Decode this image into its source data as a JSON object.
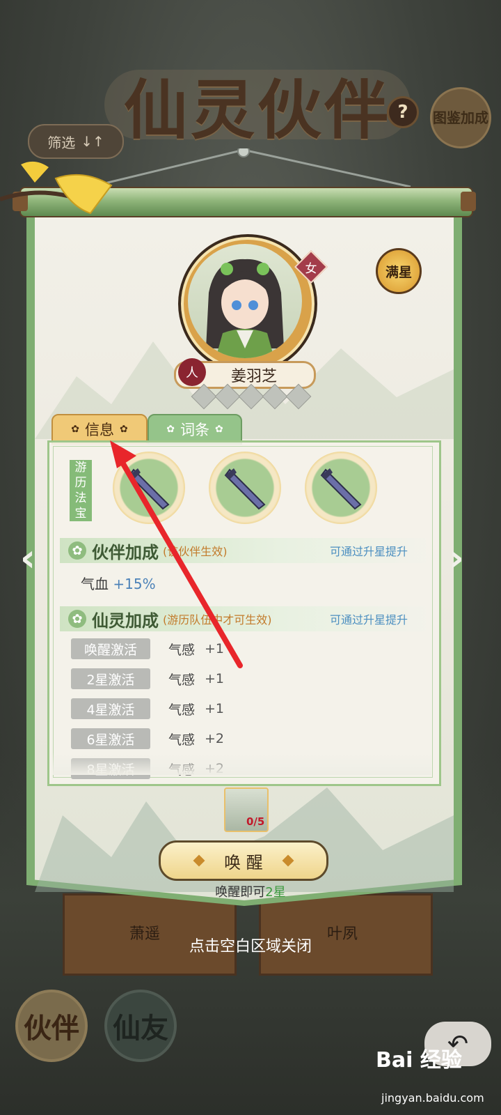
{
  "header": {
    "title": "仙灵伙伴",
    "help_label": "?",
    "codex_label": "图鉴加成",
    "filter_label": "筛选",
    "filter_icon": "↓↑"
  },
  "character": {
    "name": "姜羽芝",
    "gender": "女",
    "race": "人",
    "full_star_label": "满星",
    "star_slots": 5
  },
  "tabs": [
    {
      "label": "信息",
      "active": true
    },
    {
      "label": "词条",
      "active": false
    }
  ],
  "treasure": {
    "label": "游历法宝",
    "slots": 3
  },
  "partner_bonus": {
    "title": "伙伴加成",
    "note": "(该伙伴生效)",
    "hint": "可通过升星提升",
    "stat_name": "气血",
    "stat_value": "+15%"
  },
  "spirit_bonus": {
    "title": "仙灵加成",
    "note": "(游历队伍中才可生效)",
    "hint": "可通过升星提升",
    "rows": [
      {
        "label": "唤醒激活",
        "stat": "气感",
        "value": "+1"
      },
      {
        "label": "2星激活",
        "stat": "气感",
        "value": "+1"
      },
      {
        "label": "4星激活",
        "stat": "气感",
        "value": "+1"
      },
      {
        "label": "6星激活",
        "stat": "气感",
        "value": "+2"
      },
      {
        "label": "8星激活",
        "stat": "气感",
        "value": "+2"
      }
    ]
  },
  "fragment": {
    "count": "0/5"
  },
  "awaken": {
    "button_label": "唤 醒",
    "hint_prefix": "唤醒即可",
    "hint_star": "2星"
  },
  "background_cards": [
    {
      "name": "萧遥"
    },
    {
      "name": "叶夙"
    }
  ],
  "close_hint": "点击空白区域关闭",
  "bottom_nav": {
    "partner": "伙伴",
    "immortal": "仙友",
    "back_icon": "back-arrow-icon"
  },
  "watermark": {
    "brand": "Bai 经验",
    "url": "jingyan.baidu.com"
  },
  "colors": {
    "scroll_green": "#7fae72",
    "tab_active": "#f0c977",
    "tab_inactive": "#95c48a",
    "hint_blue": "#4c8fc0",
    "note_orange": "#c27a2a",
    "annotation_red": "#e8262b"
  }
}
